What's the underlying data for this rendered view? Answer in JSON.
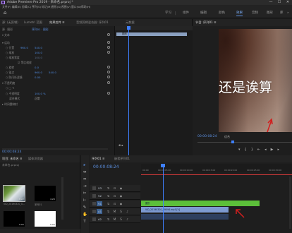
{
  "titlebar": {
    "title": "Adobe Premiere Pro 2019 - 未命名.prproj *",
    "min": "—",
    "max": "☐",
    "close": "✕"
  },
  "menubar": {
    "items": [
      "文件(F)",
      "编辑(E)",
      "剪辑(C)",
      "序列(S)",
      "标记(M)",
      "图形(G)",
      "视图(V)",
      "窗口(W)",
      "帮助(H)"
    ]
  },
  "workspaces": {
    "items": [
      "学习",
      "组件",
      "编辑",
      "颜色",
      "效果",
      "音频",
      "图形",
      "库"
    ],
    "active_index": 4,
    "more": "»"
  },
  "effect_controls": {
    "tabs": [
      "源: (无剪辑)",
      "Lumetri 范围",
      "效果控件 ≡",
      "音频剪辑混合器: 序列01",
      "元数据"
    ],
    "active_tab": 2,
    "source_label": "源 · 图形",
    "sequence_label": "序列01 · 图形",
    "rows": [
      {
        "label": "▾ 文本",
        "values": []
      },
      {
        "label": "▾ 运动",
        "values": []
      },
      {
        "label": "○ 位置",
        "values": [
          "960.0",
          "540.0"
        ]
      },
      {
        "label": "○ 缩放",
        "values": [
          "100.0"
        ]
      },
      {
        "label": "○ 缩放宽度",
        "values": [
          "100.0"
        ]
      },
      {
        "label": "☑ 等比缩放",
        "values": []
      },
      {
        "label": "○ 旋转",
        "values": [
          "0.0"
        ]
      },
      {
        "label": "○ 锚点",
        "values": [
          "960.0",
          "540.0"
        ]
      },
      {
        "label": "○ 防闪烁滤镜",
        "values": [
          "0.00"
        ]
      },
      {
        "label": "▾ 不透明度",
        "values": []
      },
      {
        "label": "○ □ ✎",
        "values": []
      },
      {
        "label": "○ 不透明度",
        "values": [
          "100.0 %"
        ]
      },
      {
        "label": "混合模式",
        "values": [
          "正常"
        ]
      },
      {
        "label": "▸ 时间重映射",
        "values": []
      }
    ],
    "clip_bar_label": "图形",
    "timecode": "00:00:08:24",
    "mini_marker": "⊕ ▸"
  },
  "program_monitor": {
    "tab": "节目: 序列01 ≡",
    "video_text": "还是诶算",
    "timecode": "00:00:08:24",
    "fit": "适合",
    "transport": [
      "▾",
      "{",
      "}",
      "⇤",
      "◂",
      "▶",
      "▸"
    ]
  },
  "project": {
    "tabs": [
      "项目: 未命名 ≡",
      "媒体浏览器"
    ],
    "bin": "未命名.prproj",
    "items": [
      {
        "name": "VID_20190320_0...",
        "dur": "8:22",
        "kind": "video"
      },
      {
        "name": "序列01",
        "dur": "4:29",
        "kind": "black"
      },
      {
        "name": "黑场",
        "dur": "5:00",
        "kind": "black"
      },
      {
        "name": "白场",
        "dur": "5:00",
        "kind": "white"
      }
    ],
    "count": "4 项"
  },
  "tools": [
    "▸",
    "⇹",
    "⇔",
    "⇥",
    "✂",
    "⊢",
    "✎",
    "✋",
    "T"
  ],
  "timeline": {
    "tab": "序列01 ≡",
    "tab2": "嵌套序列01",
    "timecode": "00:00:08:24",
    "ticks": [
      "00:00",
      "00:00:05:00",
      "00:00:10:00",
      "00:00:15:00",
      "00:00:20:00",
      "00:00:25:00",
      "00:00:30:00"
    ],
    "tracks": [
      {
        "name": "V3"
      },
      {
        "name": "V2"
      },
      {
        "name": "V1"
      },
      {
        "name": "A1"
      },
      {
        "name": "A2"
      }
    ],
    "clip_green": "图形",
    "clip_blue": "VID_20190320_09094.mp4 [V]"
  }
}
